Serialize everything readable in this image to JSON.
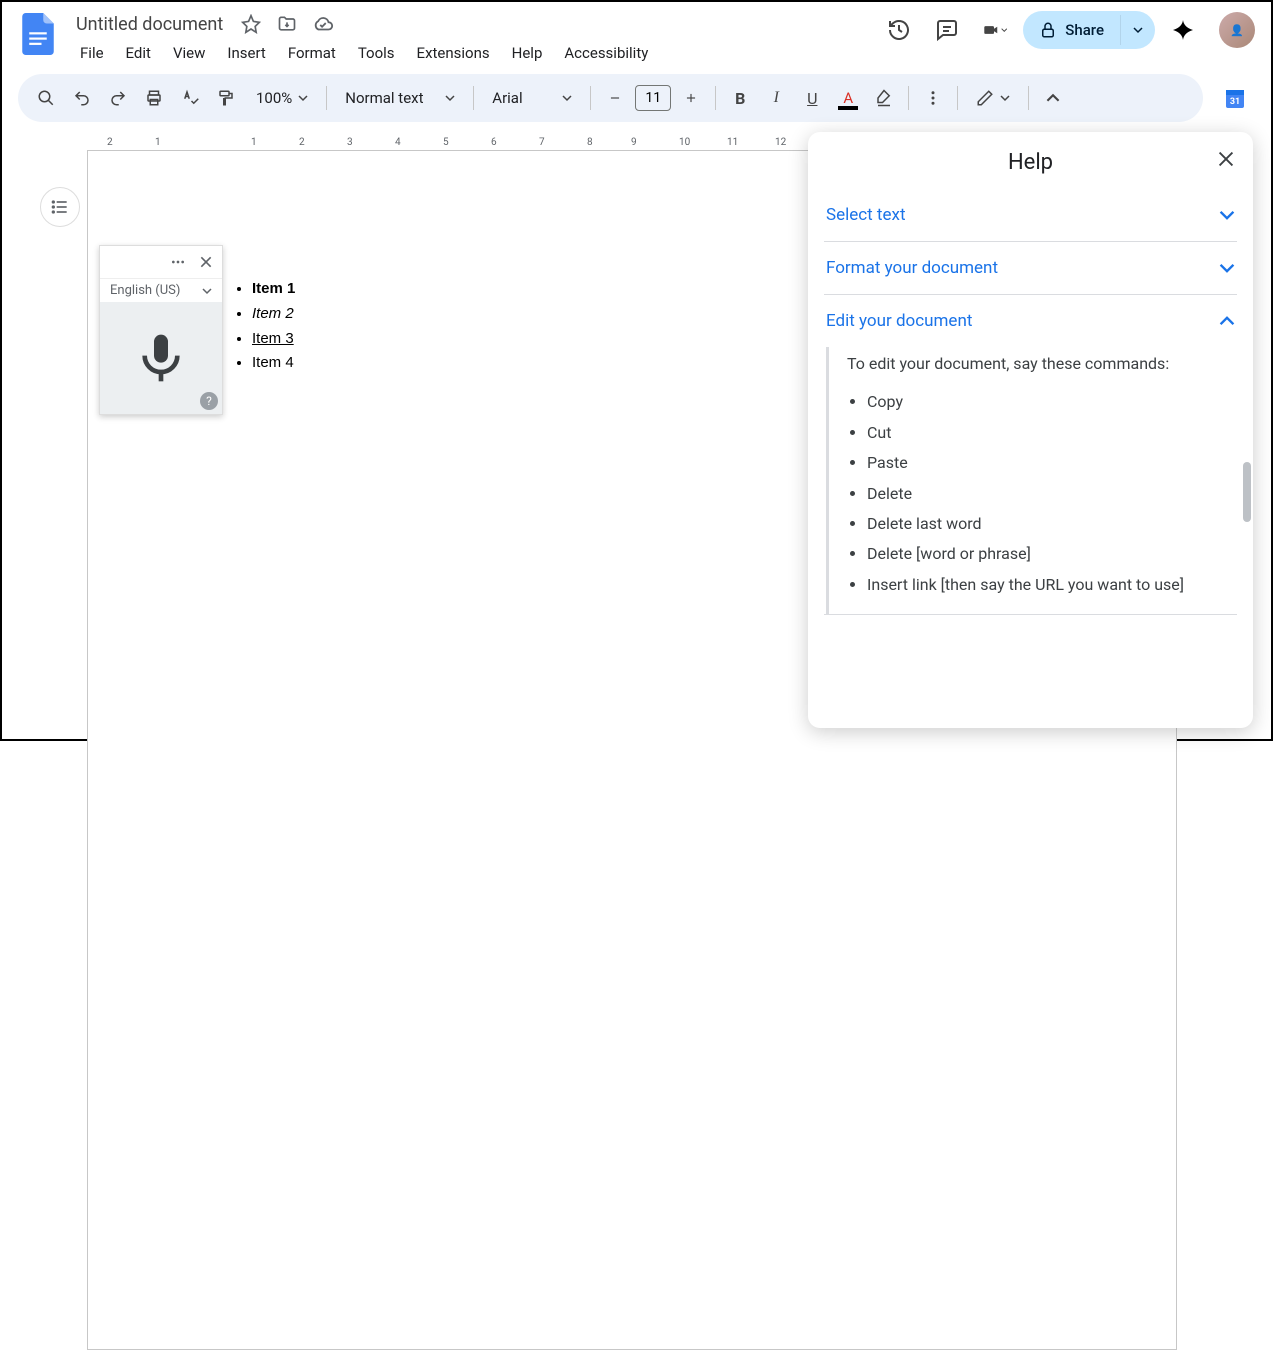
{
  "doc": {
    "title": "Untitled document"
  },
  "menus": [
    "File",
    "Edit",
    "View",
    "Insert",
    "Format",
    "Tools",
    "Extensions",
    "Help",
    "Accessibility"
  ],
  "share": {
    "label": "Share"
  },
  "toolbar": {
    "zoom": "100%",
    "style": "Normal text",
    "font": "Arial",
    "font_size": "11"
  },
  "ruler_marks": [
    "2",
    "1",
    "",
    "1",
    "2",
    "3",
    "4",
    "5",
    "6",
    "7",
    "8",
    "9",
    "10",
    "11",
    "12"
  ],
  "voice": {
    "language": "English (US)"
  },
  "document_items": [
    {
      "text": "Item 1",
      "style": "b"
    },
    {
      "text": "Item 2",
      "style": "i"
    },
    {
      "text": "Item 3",
      "style": "u"
    },
    {
      "text": "Item 4",
      "style": ""
    }
  ],
  "help": {
    "title": "Help",
    "sections": {
      "select": {
        "label": "Select text"
      },
      "format": {
        "label": "Format your document"
      },
      "edit": {
        "label": "Edit your document",
        "intro": "To edit your document, say these commands:",
        "commands": [
          "Copy",
          "Cut",
          "Paste",
          "Delete",
          "Delete last word",
          "Delete [word or phrase]",
          "Insert link [then say the URL you want to use]"
        ]
      }
    }
  }
}
